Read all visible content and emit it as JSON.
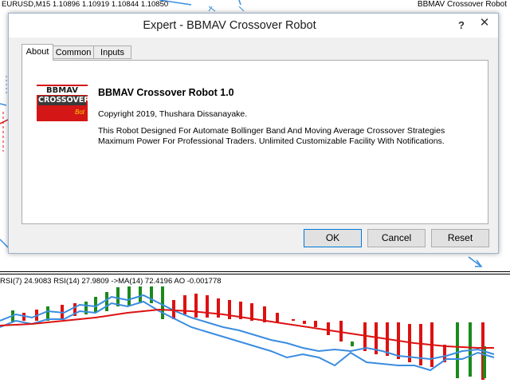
{
  "chart": {
    "header": "EURUSD,M15  1.10896 1.10919 1.10844 1.10850",
    "robot_label": "BBMAV Crossover Robot",
    "indicator_label": "RSI(7) 24.9083  RSI(14) 27.9809  ->MA(14) 72.4196  AO -0.001778"
  },
  "dialog": {
    "title": "Expert - BBMAV Crossover Robot",
    "help_glyph": "?",
    "close_glyph": "✕",
    "tabs": [
      {
        "label": "About",
        "active": true
      },
      {
        "label": "Common",
        "active": false
      },
      {
        "label": "Inputs",
        "active": false
      }
    ],
    "about": {
      "logo": {
        "line1": "BBMAV",
        "line2": "CROSSOVER",
        "line3": "Bot"
      },
      "product_title": "BBMAV Crossover Robot 1.0",
      "copyright": "Copyright 2019, Thushara Dissanayake.",
      "description_line1": "This Robot Designed For Automate Bollinger Band And Moving Average Crossover Strategies",
      "description_line2": "Maximum Power For Professional Traders. Unlimited Customizable Facility With Notifications."
    },
    "buttons": {
      "ok": "OK",
      "cancel": "Cancel",
      "reset": "Reset"
    }
  },
  "colors": {
    "bull_bar": "#1a8a1a",
    "bear_bar": "#dd1111",
    "band_line": "#3a8de0",
    "ma_line": "#dd1111",
    "accent": "#0078d7"
  }
}
